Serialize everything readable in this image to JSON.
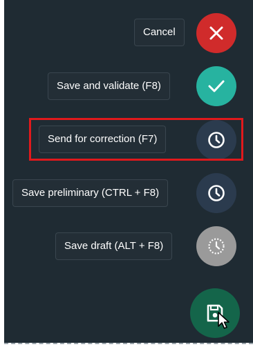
{
  "actions": {
    "cancel": {
      "label": "Cancel",
      "icon": "close-icon",
      "color": "#d02b2b"
    },
    "save_validate": {
      "label": "Save and validate (F8)",
      "icon": "check-icon",
      "color": "#27b3a0"
    },
    "send_correction": {
      "label": "Send for correction (F7)",
      "icon": "clock-icon",
      "color": "#2b3b4e"
    },
    "save_preliminary": {
      "label": "Save preliminary (CTRL + F8)",
      "icon": "clock-icon",
      "color": "#2b3b4e"
    },
    "save_draft": {
      "label": "Save draft (ALT + F8)",
      "icon": "clock-icon",
      "color": "#9a9a9a"
    }
  },
  "main_button": {
    "icon": "save-icon",
    "color": "#14654a"
  },
  "highlight": {
    "target": "send_correction",
    "color": "#e0191c"
  },
  "panel": {
    "background": "#1f2b33"
  }
}
